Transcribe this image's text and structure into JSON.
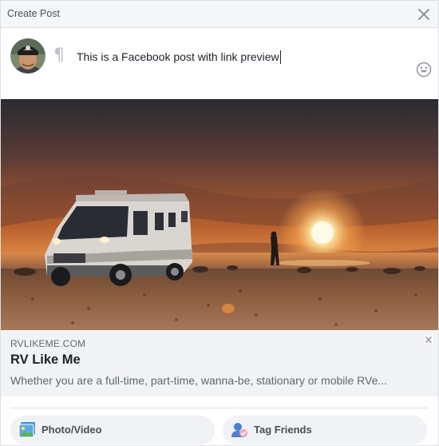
{
  "header": {
    "title": "Create Post"
  },
  "composer": {
    "pilcrow": "¶",
    "text": "This is a Facebook post with link preview"
  },
  "link_preview": {
    "domain": "RVLIKEME.COM",
    "title": "RV Like Me",
    "description": "Whether you are a full-time, part-time, wanna-be, stationary or mobile RVe..."
  },
  "actions": {
    "photo_video": "Photo/Video",
    "tag_friends": "Tag Friends"
  },
  "colors": {
    "header_bg": "#f5f6f7",
    "preview_bg": "#f2f3f5",
    "button_bg": "#f0f2f5",
    "text_primary": "#1d2129",
    "text_secondary": "#606770"
  }
}
